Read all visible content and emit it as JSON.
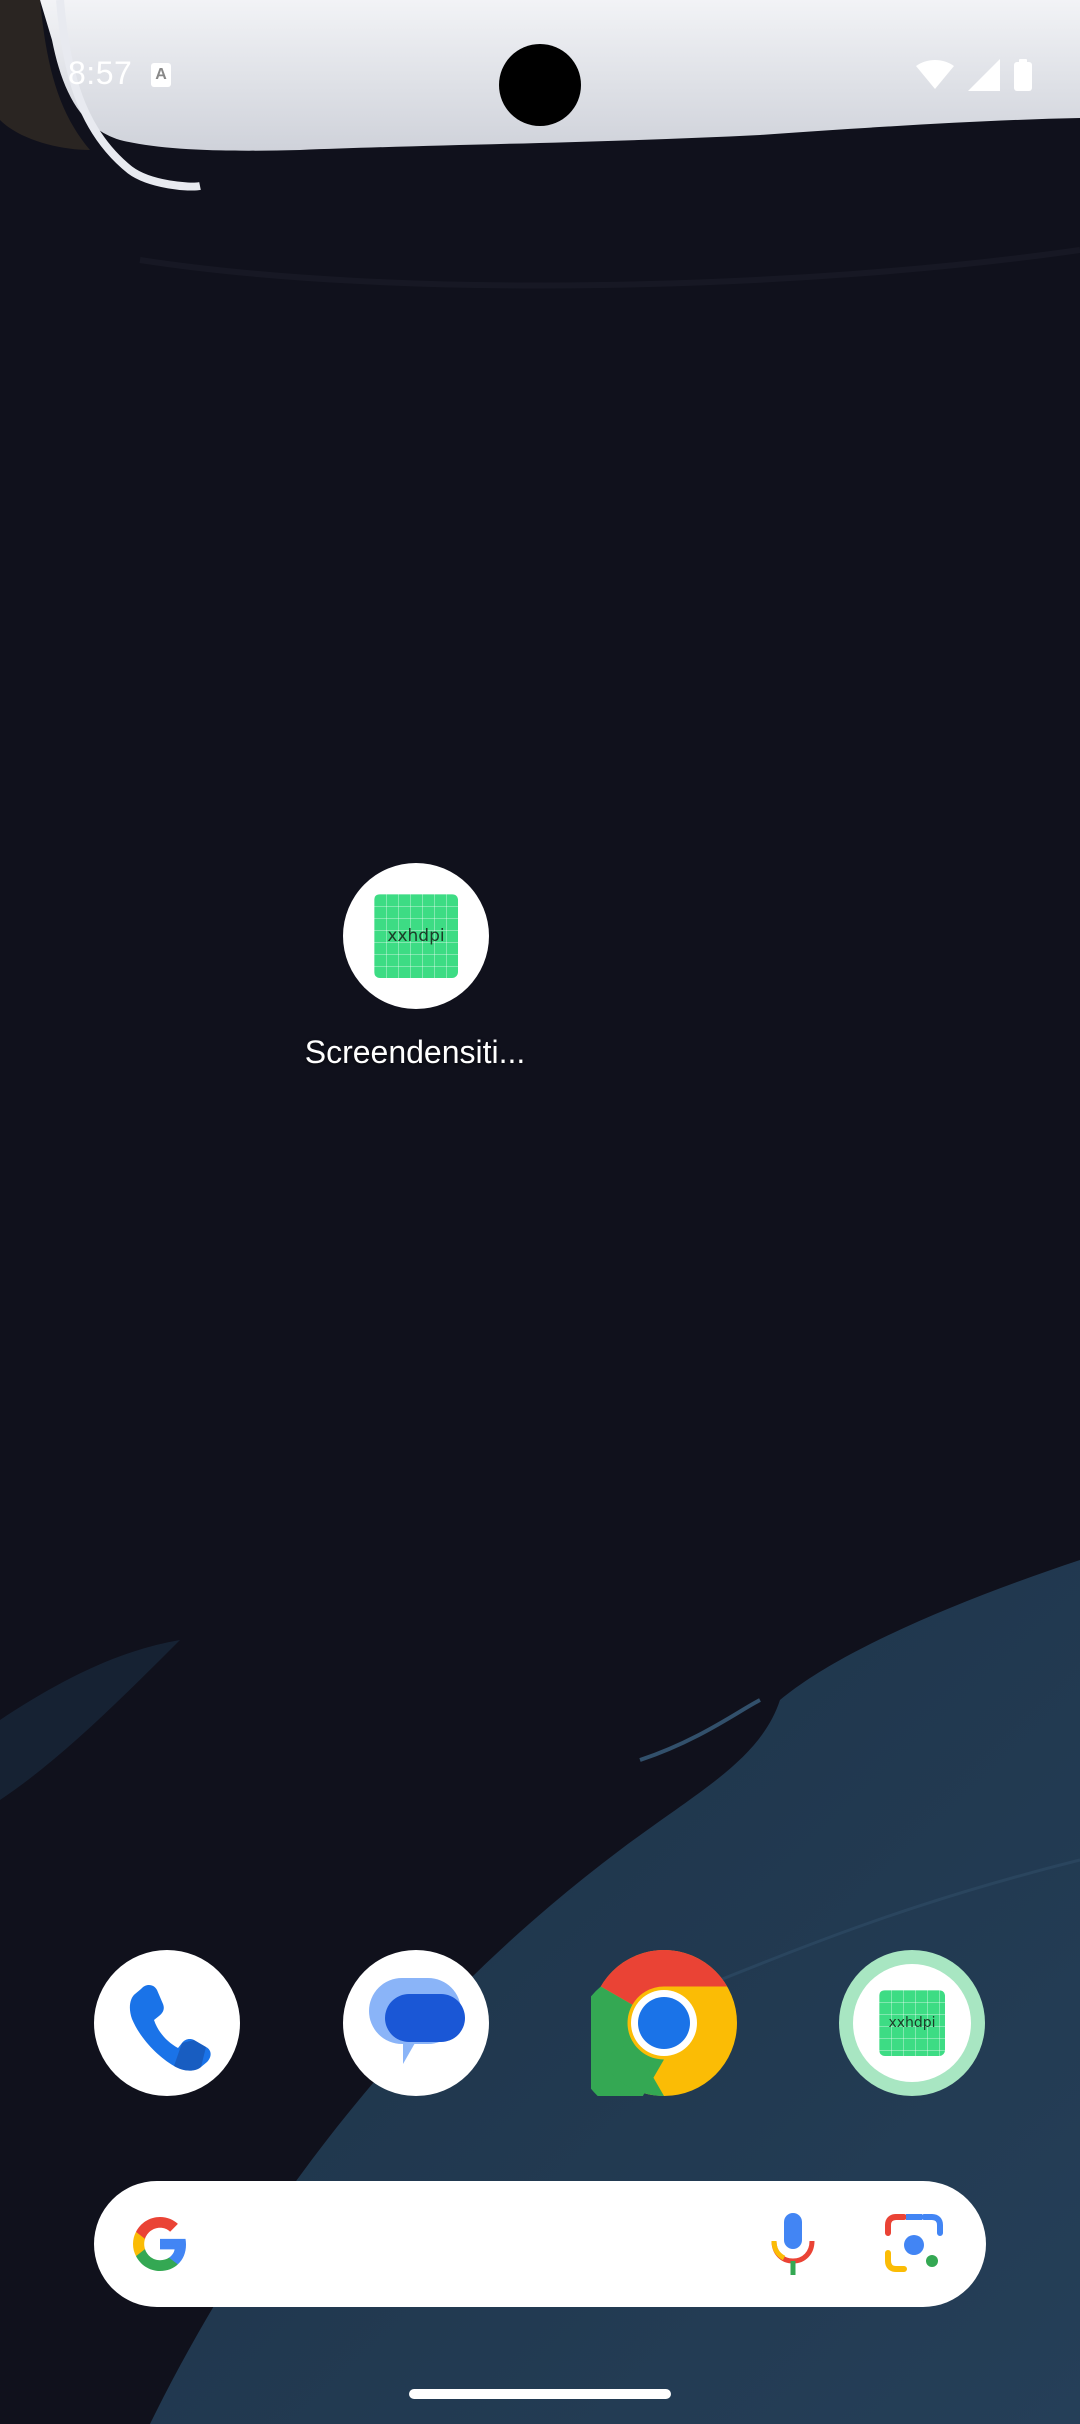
{
  "status_bar": {
    "time": "8:57",
    "notification_icon": "android-system-notification-icon",
    "icons": [
      "wifi-icon",
      "signal-icon",
      "battery-icon"
    ]
  },
  "home": {
    "apps": [
      {
        "label": "Screendensiti...",
        "icon_text": "xxhdpi",
        "icon": "screen-density-app-icon"
      }
    ]
  },
  "dock": {
    "apps": [
      {
        "name": "Phone",
        "icon": "phone-icon"
      },
      {
        "name": "Messages",
        "icon": "messages-icon"
      },
      {
        "name": "Chrome",
        "icon": "chrome-icon"
      },
      {
        "name": "Screendensities",
        "icon": "screen-density-app-icon",
        "icon_text": "xxhdpi"
      }
    ]
  },
  "search_bar": {
    "logo": "google-g-icon",
    "mic": "mic-icon",
    "lens": "google-lens-icon"
  },
  "colors": {
    "background": "#10111c",
    "wave": "#223a52",
    "density_green": "#3ddc84",
    "google_blue": "#4285f4",
    "google_red": "#ea4335",
    "google_yellow": "#fbbc05",
    "google_green": "#34a853"
  }
}
